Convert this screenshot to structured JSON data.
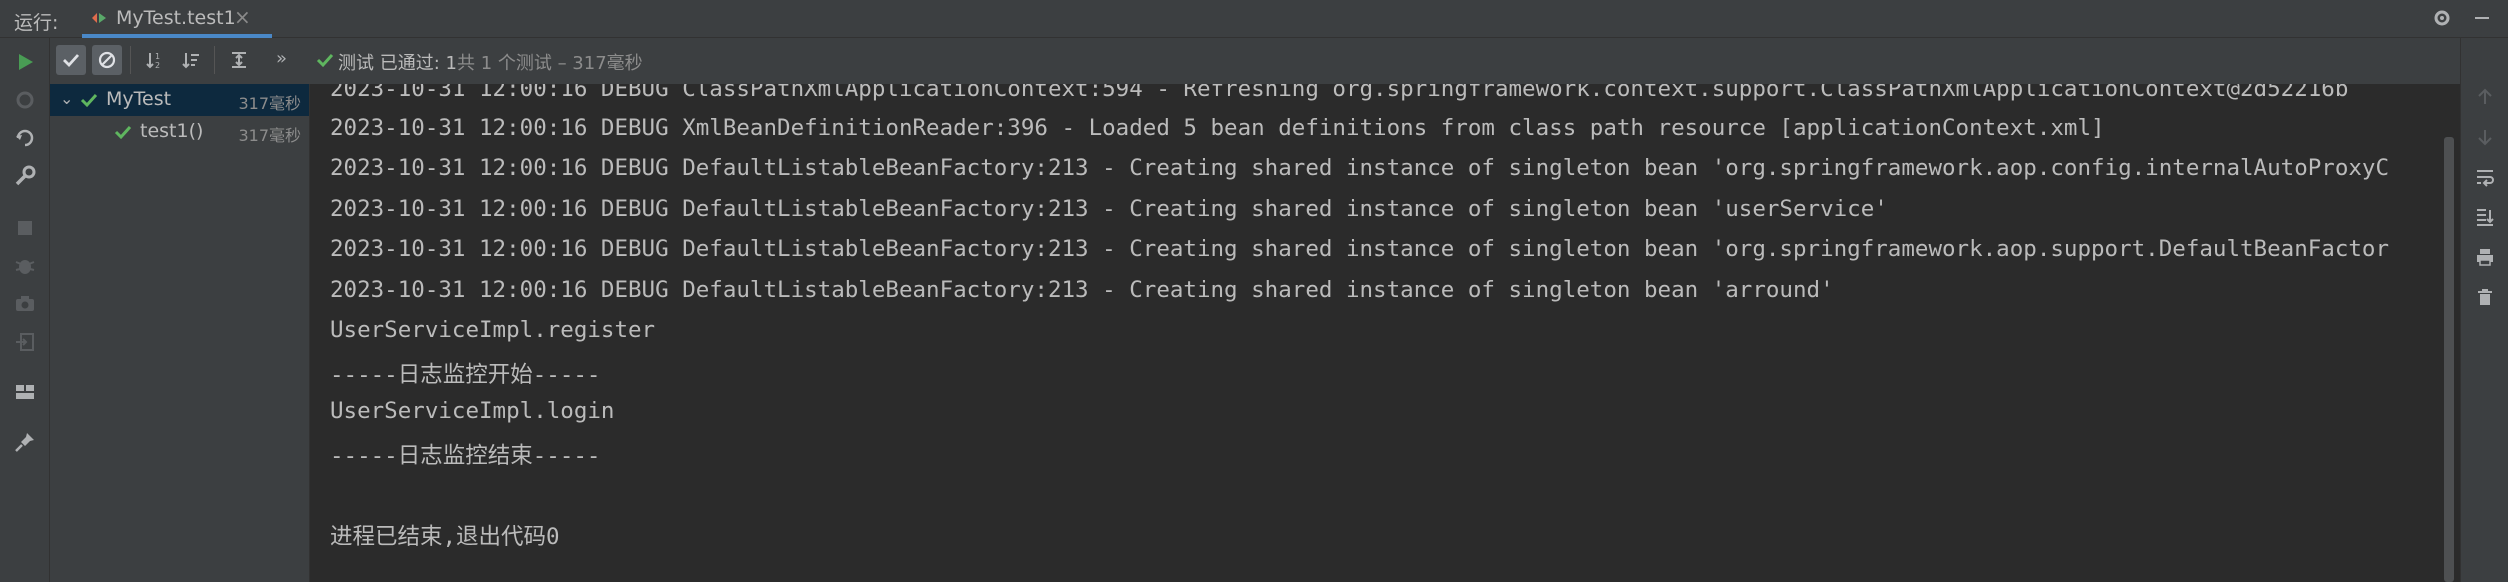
{
  "header": {
    "run_label": "运行:",
    "tab_title": "MyTest.test1",
    "tab_close": "×"
  },
  "status": {
    "passed": "测试 已通过: 1",
    "summary": "共 1 个测试 – 317毫秒"
  },
  "tree": {
    "items": [
      {
        "name": "MyTest",
        "time": "317毫秒"
      },
      {
        "name": "test1()",
        "time": "317毫秒"
      }
    ]
  },
  "console": {
    "lines": [
      "2023-10-31 12:00:16 DEBUG ClassPathXmlApplicationContext:594 - Refreshing org.springframework.context.support.ClassPathXmlApplicationContext@2d52216b",
      "2023-10-31 12:00:16 DEBUG XmlBeanDefinitionReader:396 - Loaded 5 bean definitions from class path resource [applicationContext.xml]",
      "2023-10-31 12:00:16 DEBUG DefaultListableBeanFactory:213 - Creating shared instance of singleton bean 'org.springframework.aop.config.internalAutoProxyC",
      "2023-10-31 12:00:16 DEBUG DefaultListableBeanFactory:213 - Creating shared instance of singleton bean 'userService'",
      "2023-10-31 12:00:16 DEBUG DefaultListableBeanFactory:213 - Creating shared instance of singleton bean 'org.springframework.aop.support.DefaultBeanFactor",
      "2023-10-31 12:00:16 DEBUG DefaultListableBeanFactory:213 - Creating shared instance of singleton bean 'arround'",
      "UserServiceImpl.register",
      "-----日志监控开始-----",
      "UserServiceImpl.login",
      "-----日志监控结束-----",
      "",
      "进程已结束,退出代码0"
    ]
  },
  "colors": {
    "success": "#5fb65f",
    "run_green": "#499c54",
    "accent": "#4a88c7"
  }
}
